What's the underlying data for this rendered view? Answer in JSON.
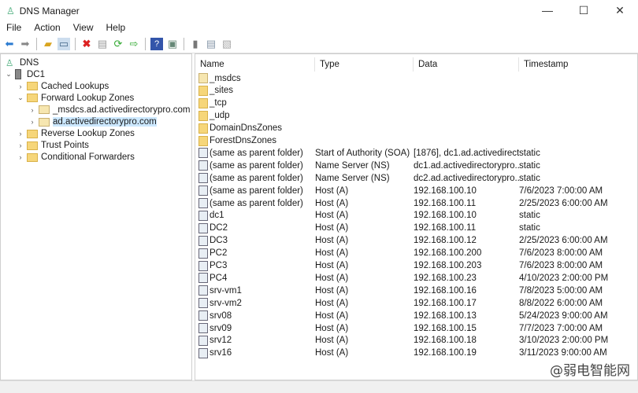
{
  "window": {
    "title": "DNS Manager",
    "minimize": "—",
    "maximize": "☐",
    "close": "✕"
  },
  "menu": [
    "File",
    "Action",
    "View",
    "Help"
  ],
  "toolbar": [
    "back-icon",
    "forward-icon",
    "up-folder-icon",
    "show-hide-tree-icon",
    "delete-icon",
    "properties-icon",
    "refresh-icon",
    "export-icon",
    "help-icon",
    "console-icon",
    "server-icon",
    "list-icon",
    "records-icon"
  ],
  "tree": [
    {
      "label": "DNS",
      "level": 0,
      "chev": "",
      "icon": "dns"
    },
    {
      "label": "DC1",
      "level": 0,
      "chev": "⌄",
      "icon": "server"
    },
    {
      "label": "Cached Lookups",
      "level": 1,
      "chev": "›",
      "icon": "folder"
    },
    {
      "label": "Forward Lookup Zones",
      "level": 1,
      "chev": "⌄",
      "icon": "folder"
    },
    {
      "label": "_msdcs.ad.activedirectorypro.com",
      "level": 2,
      "chev": "›",
      "icon": "zone"
    },
    {
      "label": "ad.activedirectorypro.com",
      "level": 2,
      "chev": "›",
      "icon": "zone",
      "selected": true
    },
    {
      "label": "Reverse Lookup Zones",
      "level": 1,
      "chev": "›",
      "icon": "folder"
    },
    {
      "label": "Trust Points",
      "level": 1,
      "chev": "›",
      "icon": "folder"
    },
    {
      "label": "Conditional Forwarders",
      "level": 1,
      "chev": "›",
      "icon": "folder"
    }
  ],
  "columns": [
    "Name",
    "Type",
    "Data",
    "Timestamp"
  ],
  "rows": [
    {
      "name": "_msdcs",
      "type": "",
      "data": "",
      "ts": "",
      "icon": "zone"
    },
    {
      "name": "_sites",
      "type": "",
      "data": "",
      "ts": "",
      "icon": "folder"
    },
    {
      "name": "_tcp",
      "type": "",
      "data": "",
      "ts": "",
      "icon": "folder"
    },
    {
      "name": "_udp",
      "type": "",
      "data": "",
      "ts": "",
      "icon": "folder"
    },
    {
      "name": "DomainDnsZones",
      "type": "",
      "data": "",
      "ts": "",
      "icon": "folder"
    },
    {
      "name": "ForestDnsZones",
      "type": "",
      "data": "",
      "ts": "",
      "icon": "folder"
    },
    {
      "name": "(same as parent folder)",
      "type": "Start of Authority (SOA)",
      "data": "[1876], dc1.ad.activedirect...",
      "ts": "static",
      "icon": "rec"
    },
    {
      "name": "(same as parent folder)",
      "type": "Name Server (NS)",
      "data": "dc1.ad.activedirectorypro....",
      "ts": "static",
      "icon": "rec"
    },
    {
      "name": "(same as parent folder)",
      "type": "Name Server (NS)",
      "data": "dc2.ad.activedirectorypro....",
      "ts": "static",
      "icon": "rec"
    },
    {
      "name": "(same as parent folder)",
      "type": "Host (A)",
      "data": "192.168.100.10",
      "ts": "7/6/2023 7:00:00 AM",
      "icon": "rec"
    },
    {
      "name": "(same as parent folder)",
      "type": "Host (A)",
      "data": "192.168.100.11",
      "ts": "2/25/2023 6:00:00 AM",
      "icon": "rec"
    },
    {
      "name": "dc1",
      "type": "Host (A)",
      "data": "192.168.100.10",
      "ts": "static",
      "icon": "rec"
    },
    {
      "name": "DC2",
      "type": "Host (A)",
      "data": "192.168.100.11",
      "ts": "static",
      "icon": "rec"
    },
    {
      "name": "DC3",
      "type": "Host (A)",
      "data": "192.168.100.12",
      "ts": "2/25/2023 6:00:00 AM",
      "icon": "rec"
    },
    {
      "name": "PC2",
      "type": "Host (A)",
      "data": "192.168.100.200",
      "ts": "7/6/2023 8:00:00 AM",
      "icon": "rec"
    },
    {
      "name": "PC3",
      "type": "Host (A)",
      "data": "192.168.100.203",
      "ts": "7/6/2023 8:00:00 AM",
      "icon": "rec"
    },
    {
      "name": "PC4",
      "type": "Host (A)",
      "data": "192.168.100.23",
      "ts": "4/10/2023 2:00:00 PM",
      "icon": "rec"
    },
    {
      "name": "srv-vm1",
      "type": "Host (A)",
      "data": "192.168.100.16",
      "ts": "7/8/2023 5:00:00 AM",
      "icon": "rec"
    },
    {
      "name": "srv-vm2",
      "type": "Host (A)",
      "data": "192.168.100.17",
      "ts": "8/8/2022 6:00:00 AM",
      "icon": "rec"
    },
    {
      "name": "srv08",
      "type": "Host (A)",
      "data": "192.168.100.13",
      "ts": "5/24/2023 9:00:00 AM",
      "icon": "rec"
    },
    {
      "name": "srv09",
      "type": "Host (A)",
      "data": "192.168.100.15",
      "ts": "7/7/2023 7:00:00 AM",
      "icon": "rec"
    },
    {
      "name": "srv12",
      "type": "Host (A)",
      "data": "192.168.100.18",
      "ts": "3/10/2023 2:00:00 PM",
      "icon": "rec"
    },
    {
      "name": "srv16",
      "type": "Host (A)",
      "data": "192.168.100.19",
      "ts": "3/11/2023 9:00:00 AM",
      "icon": "rec"
    }
  ],
  "watermark": "@弱电智能网"
}
